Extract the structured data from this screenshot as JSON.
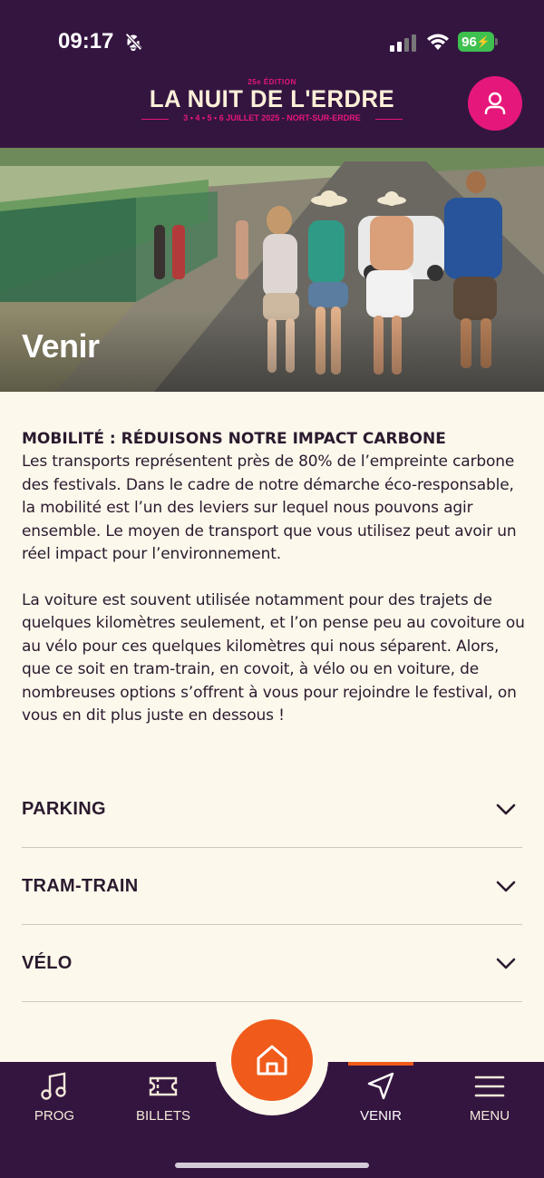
{
  "status_bar": {
    "time": "09:17",
    "battery": "96"
  },
  "header": {
    "logo": {
      "edition": "25e ÉDITION",
      "title": "LA NUIT DE L'ERDRE",
      "dates": "3 • 4 • 5 • 6 JUILLET 2025",
      "location": "NORT-SUR-ERDRE"
    },
    "profile_icon": "user-icon"
  },
  "hero": {
    "title": "Venir"
  },
  "content": {
    "section_title": "MOBILITÉ : RÉDUISONS NOTRE IMPACT CARBONE",
    "paragraph_1": "Les transports représentent près de 80% de l’empreinte carbone des festivals. Dans le cadre de notre démarche éco-responsable, la mobilité est l’un des leviers sur lequel nous pouvons agir ensemble. Le moyen de transport que vous utilisez peut avoir un réel impact pour l’environnement.",
    "paragraph_2": "La voiture est souvent utilisée notamment pour des trajets de quelques kilomètres seulement, et l’on pense peu au covoiture ou au vélo pour ces quelques kilomètres qui nous séparent. Alors, que ce soit en tram-train, en covoit, à vélo ou en voiture, de nombreuses options s’offrent à vous pour rejoindre le festival, on vous en dit plus juste en dessous !"
  },
  "accordion": [
    {
      "label": "PARKING"
    },
    {
      "label": "TRAM-TRAIN"
    },
    {
      "label": "VÉLO"
    }
  ],
  "tabbar": {
    "items": [
      {
        "label": "PROG",
        "icon": "music-note-icon"
      },
      {
        "label": "BILLETS",
        "icon": "ticket-icon"
      },
      {
        "label": "VENIR",
        "icon": "navigation-arrow-icon",
        "active": true
      },
      {
        "label": "MENU",
        "icon": "hamburger-menu-icon"
      }
    ],
    "home_icon": "home-icon"
  },
  "colors": {
    "header_bg": "#341540",
    "accent_pink": "#e6177b",
    "accent_orange": "#f05a1a",
    "page_bg": "#fdf8ec"
  }
}
